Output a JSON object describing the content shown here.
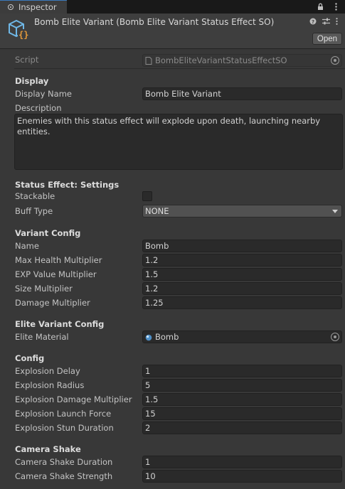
{
  "tab": {
    "label": "Inspector"
  },
  "header": {
    "title": "Bomb Elite Variant (Bomb Elite Variant Status Effect SO)",
    "open_label": "Open",
    "icons": [
      "help-icon",
      "presets-icon",
      "kebab-icon"
    ]
  },
  "script": {
    "label": "Script",
    "value": "BombEliteVariantStatusEffectSO"
  },
  "display": {
    "section": "Display",
    "display_name_label": "Display Name",
    "display_name_value": "Bomb Elite Variant",
    "description_label": "Description",
    "description_value": "Enemies with this status effect will explode upon death, launching nearby entities."
  },
  "status_settings": {
    "section": "Status Effect: Settings",
    "stackable_label": "Stackable",
    "stackable_checked": false,
    "buff_type_label": "Buff Type",
    "buff_type_value": "NONE"
  },
  "variant_config": {
    "section": "Variant Config",
    "rows": [
      {
        "label": "Name",
        "value": "Bomb"
      },
      {
        "label": "Max Health Multiplier",
        "value": "1.2"
      },
      {
        "label": "EXP Value Multiplier",
        "value": "1.5"
      },
      {
        "label": "Size Multiplier",
        "value": "1.2"
      },
      {
        "label": "Damage Multiplier",
        "value": "1.25"
      }
    ]
  },
  "elite_variant_config": {
    "section": "Elite Variant Config",
    "elite_material_label": "Elite Material",
    "elite_material_value": "Bomb"
  },
  "config": {
    "section": "Config",
    "rows": [
      {
        "label": "Explosion Delay",
        "value": "1"
      },
      {
        "label": "Explosion Radius",
        "value": "5"
      },
      {
        "label": "Explosion Damage Multiplier",
        "value": "1.5"
      },
      {
        "label": "Explosion Launch Force",
        "value": "15"
      },
      {
        "label": "Explosion Stun Duration",
        "value": "2"
      }
    ]
  },
  "camera_shake": {
    "section": "Camera Shake",
    "rows": [
      {
        "label": "Camera Shake Duration",
        "value": "1"
      },
      {
        "label": "Camera Shake Strength",
        "value": "10"
      }
    ]
  },
  "colors": {
    "background": "#383838",
    "field": "#2a2a2a",
    "accent": "#3a79bb",
    "icon_blue": "#6fb7e6",
    "icon_orange": "#e59a3a"
  }
}
